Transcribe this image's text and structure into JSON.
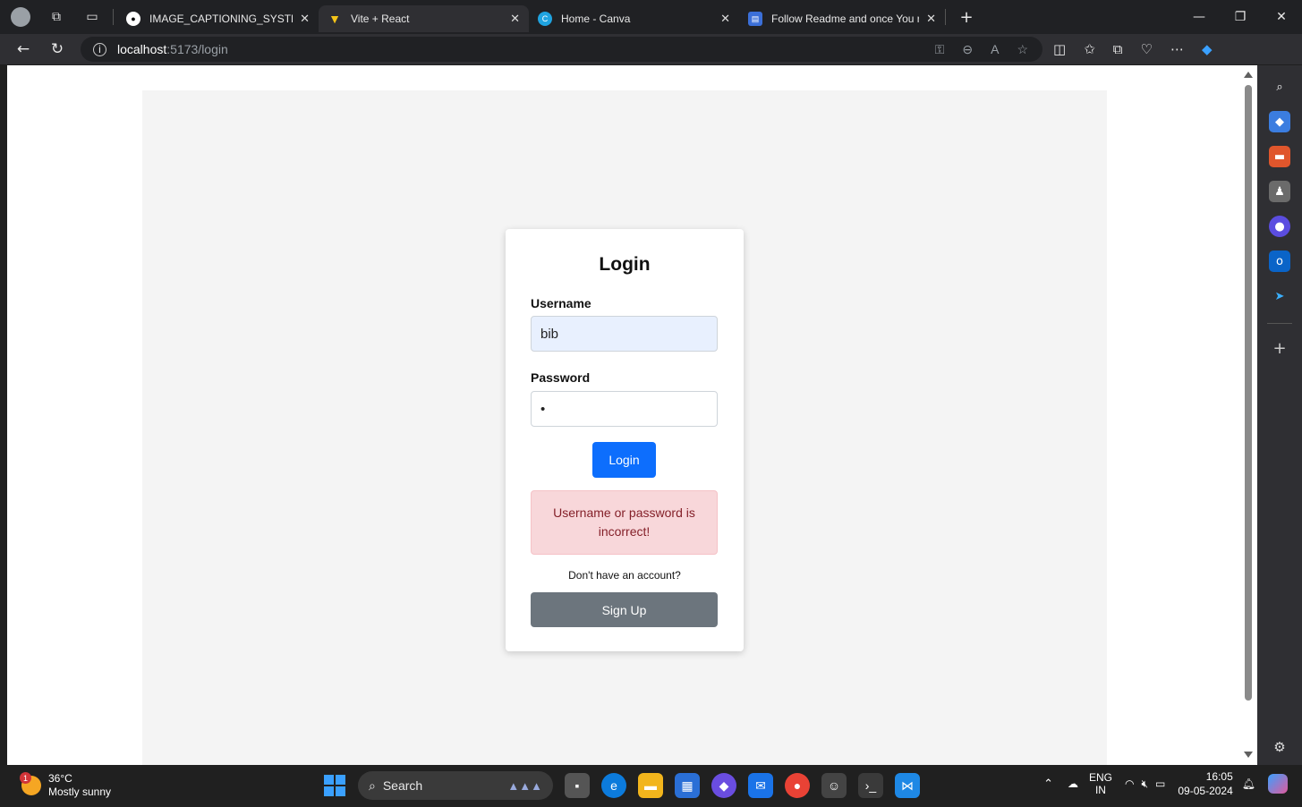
{
  "browser": {
    "tabs": [
      {
        "title": "IMAGE_CAPTIONING_SYSTEM/RE",
        "icon": "github-icon",
        "active": false
      },
      {
        "title": "Vite + React",
        "icon": "vite-icon",
        "active": true
      },
      {
        "title": "Home - Canva",
        "icon": "canva-icon",
        "active": false
      },
      {
        "title": "Follow Readme and once You rea",
        "icon": "app-icon",
        "active": false
      }
    ],
    "url_host": "localhost",
    "url_path": ":5173/login"
  },
  "login": {
    "title": "Login",
    "username_label": "Username",
    "username_value": "bib",
    "password_label": "Password",
    "password_value": "•",
    "login_button": "Login",
    "error_message": "Username or password is incorrect!",
    "no_account_text": "Don't have an account?",
    "signup_button": "Sign Up"
  },
  "taskbar": {
    "weather_temp": "36°C",
    "weather_desc": "Mostly sunny",
    "weather_badge": "1",
    "search_label": "Search",
    "lang_top": "ENG",
    "lang_bottom": "IN",
    "time": "16:05",
    "date": "09-05-2024"
  },
  "colors": {
    "primary_button": "#0d6efd",
    "secondary_button": "#6c757d",
    "alert_bg": "#f8d7da",
    "alert_text": "#842029"
  }
}
